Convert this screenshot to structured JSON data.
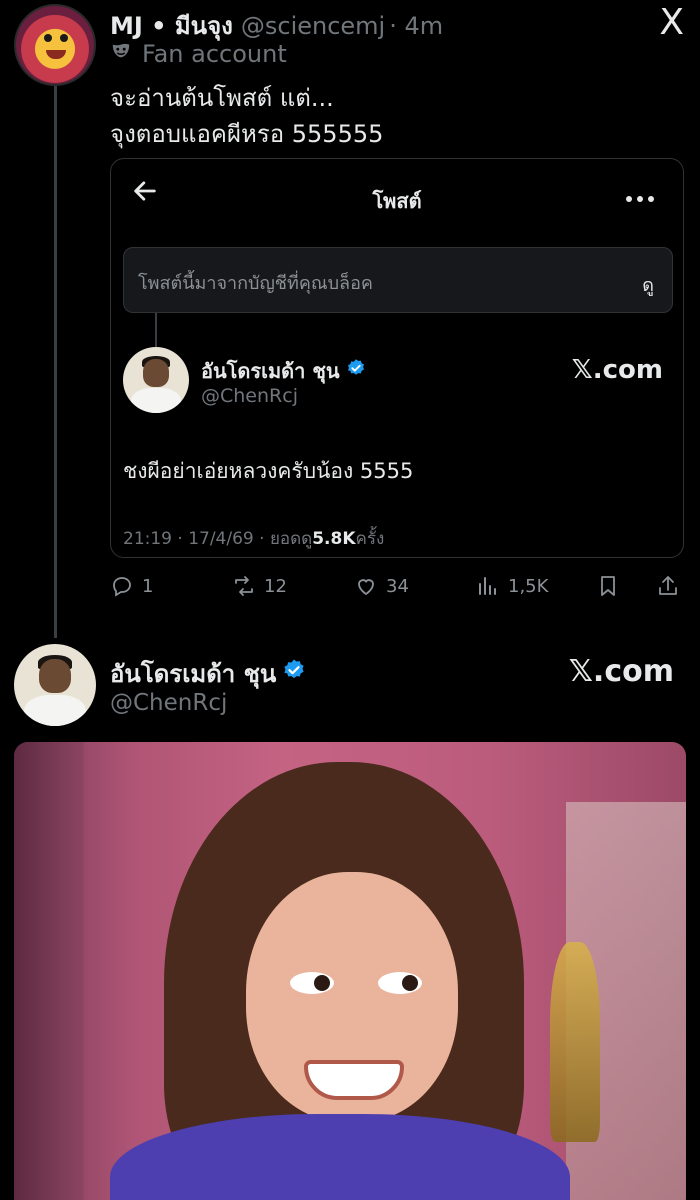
{
  "top_post": {
    "author_name": "MJ • มีนจุง",
    "handle": "@sciencemj",
    "time": "· 4m",
    "label": "Fan account",
    "text_line1": "จะอ่านต้นโพสต์ แต่...",
    "text_line2": "จุงตอบแอคผีหรอ 555555",
    "x_logo": "X"
  },
  "embedded_card": {
    "title": "โพสต์",
    "blocked_message": "โพสต์นี้มาจากบัญชีที่คุณบล็อค",
    "view_label": "ดู",
    "quoted_author": "อันโดรเมด้า ชุน",
    "quoted_handle": "@ChenRcj",
    "site_label": "𝕏.com",
    "quoted_text": "ชงผีอย่าเอ่ยหลวงครับน้อง 5555",
    "meta_prefix": "21:19 · 17/4/69 · ยอดดู ",
    "views": "5.8K",
    "meta_suffix": " ครั้ง"
  },
  "actions": {
    "replies": "1",
    "reposts": "12",
    "likes": "34",
    "views": "1,5K"
  },
  "second_post": {
    "author_name": "อันโดรเมด้า ชุน",
    "handle": "@ChenRcj",
    "site_label": "𝕏.com"
  },
  "colors": {
    "background": "#000000",
    "verified_blue": "#1d9bf0",
    "muted_text": "#71767b"
  }
}
